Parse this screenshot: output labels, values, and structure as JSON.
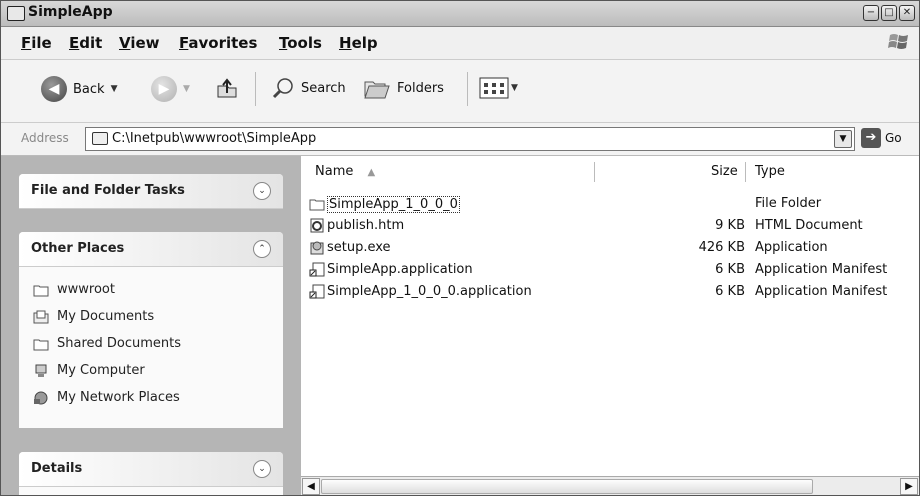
{
  "window": {
    "title": "SimpleApp"
  },
  "menu": {
    "items": [
      "File",
      "Edit",
      "View",
      "Favorites",
      "Tools",
      "Help"
    ]
  },
  "toolbar": {
    "back_label": "Back",
    "search_label": "Search",
    "folders_label": "Folders"
  },
  "address": {
    "label": "Address",
    "value": "C:\\Inetpub\\wwwroot\\SimpleApp",
    "go_label": "Go"
  },
  "left": {
    "tasks_title": "File and Folder Tasks",
    "other_title": "Other Places",
    "places": [
      "wwwroot",
      "My Documents",
      "Shared Documents",
      "My Computer",
      "My Network Places"
    ],
    "details_title": "Details"
  },
  "files": {
    "columns": {
      "name": "Name",
      "size": "Size",
      "type": "Type"
    },
    "rows": [
      {
        "name": "SimpleApp_1_0_0_0",
        "size": "",
        "type": "File Folder",
        "icon": "folder-icon"
      },
      {
        "name": "publish.htm",
        "size": "9 KB",
        "type": "HTML Document",
        "icon": "html-file-icon"
      },
      {
        "name": "setup.exe",
        "size": "426 KB",
        "type": "Application",
        "icon": "setup-exe-icon"
      },
      {
        "name": "SimpleApp.application",
        "size": "6 KB",
        "type": "Application Manifest",
        "icon": "manifest-file-icon"
      },
      {
        "name": "SimpleApp_1_0_0_0.application",
        "size": "6 KB",
        "type": "Application Manifest",
        "icon": "manifest-file-icon"
      }
    ]
  }
}
